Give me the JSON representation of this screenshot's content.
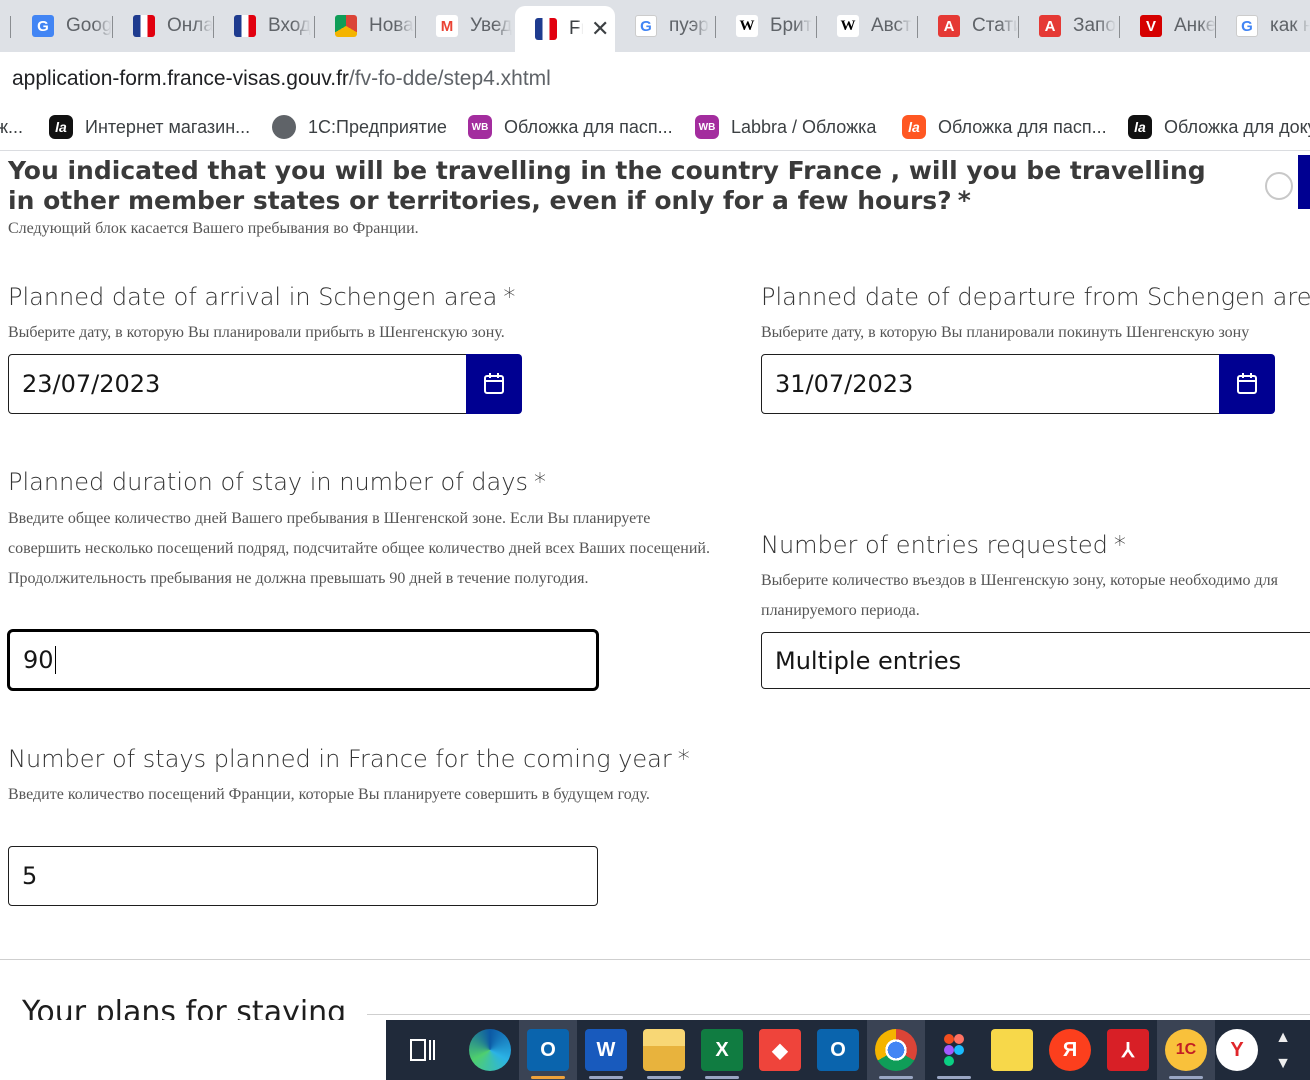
{
  "browser": {
    "tabs": [
      {
        "title": "Goog",
        "icon": "google-docs-icon"
      },
      {
        "title": "Онла",
        "icon": "france-flag-icon"
      },
      {
        "title": "Вход",
        "icon": "france-flag-icon"
      },
      {
        "title": "Нова",
        "icon": "chrome-icon"
      },
      {
        "title": "Увед",
        "icon": "gmail-icon"
      },
      {
        "title": "Fr",
        "icon": "france-flag-icon",
        "active": true
      },
      {
        "title": "пуэр",
        "icon": "google-icon"
      },
      {
        "title": "Брит",
        "icon": "wikipedia-icon"
      },
      {
        "title": "Авст",
        "icon": "wikipedia-icon"
      },
      {
        "title": "Стати",
        "icon": "a-icon"
      },
      {
        "title": "Запо",
        "icon": "a-icon"
      },
      {
        "title": "Анке",
        "icon": "v-icon"
      },
      {
        "title": "как н",
        "icon": "google-icon"
      }
    ],
    "tab_close_glyph": "✕",
    "url_host": "application-form.france-visas.gouv.fr",
    "url_path": "/fv-fo-dde/step4.xhtml",
    "bookmarks": [
      {
        "label": "ж...",
        "icon": ""
      },
      {
        "label": "Интернет магазин...",
        "icon": "la"
      },
      {
        "label": "1С:Предприятие",
        "icon": "globe"
      },
      {
        "label": "Обложка для пасп...",
        "icon": "WB"
      },
      {
        "label": "Labbra / Обложка",
        "icon": "WB"
      },
      {
        "label": "Обложка для пасп...",
        "icon": "la"
      },
      {
        "label": "Обложка для доку",
        "icon": "la"
      }
    ]
  },
  "form": {
    "question": "You indicated that you will be travelling in the country France , will you be travelling in other member states or territories, even if only for a few hours?",
    "required_mark": "*",
    "question_help": "Следующий блок касается Вашего пребывания во Франции.",
    "arrival": {
      "label": "Planned date of arrival in Schengen area",
      "help": "Выберите дату, в которую Вы планировали прибыть в Шенгенскую зону.",
      "value": "23/07/2023"
    },
    "departure": {
      "label": "Planned date of departure from Schengen area",
      "help": "Выберите дату, в которую Вы планировали покинуть Шенгенскую зону",
      "value": "31/07/2023"
    },
    "duration": {
      "label": "Planned duration of stay in number of days",
      "help": "Введите общее количество дней Вашего пребывания в Шенгенской зоне. Если Вы планируете совершить несколько посещений подряд, подсчитайте общее количество дней всех Ваших посещений. Продолжительность пребывания не должна превышать 90 дней в течение полугодия.",
      "value": "90"
    },
    "entries": {
      "label": "Number of entries requested",
      "help": "Выберите количество въездов в Шенгенскую зону, которые необходимо для планируемого периода.",
      "value": "Multiple entries"
    },
    "stays": {
      "label": "Number of stays planned in France for the coming year",
      "help": "Введите количество посещений Франции, которые Вы планируете совершить в будущем году.",
      "value": "5"
    },
    "next_section_title": "Your plans for staying"
  },
  "taskbar": {
    "apps": [
      "task-view",
      "edge",
      "outlook",
      "word",
      "file-explorer",
      "excel",
      "anydesk",
      "outlook-2",
      "chrome",
      "figma",
      "sticky-notes",
      "yandex",
      "acrobat",
      "1c",
      "yandex-browser"
    ],
    "glyphs": {
      "word": "W",
      "excel": "X",
      "outlook": "O",
      "yandex": "Я",
      "onec": "1С",
      "yandex_browser": "Y"
    }
  },
  "colors": {
    "accent": "#000091",
    "tabstrip": "#dee1e6",
    "taskbar": "#202a3a"
  }
}
